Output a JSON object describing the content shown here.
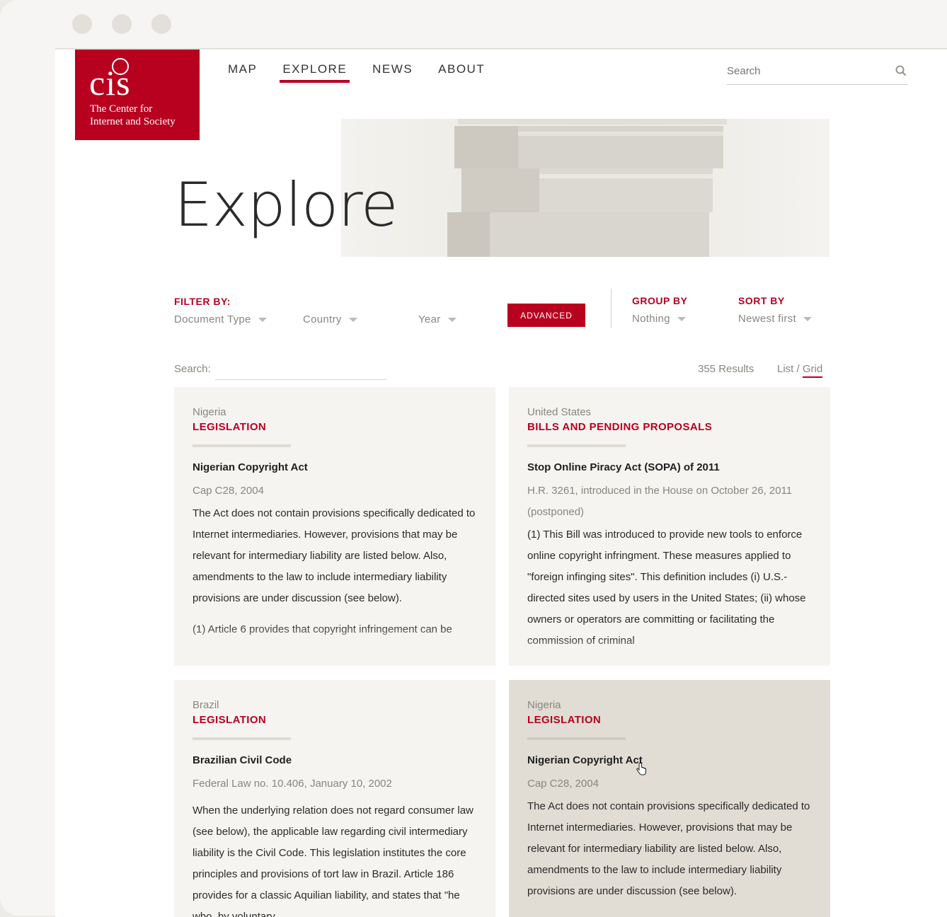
{
  "logo": {
    "mark": "cis",
    "line1": "The Center for",
    "line2": "Internet and Society"
  },
  "nav": {
    "items": [
      "MAP",
      "EXPLORE",
      "NEWS",
      "ABOUT"
    ],
    "active": "EXPLORE"
  },
  "search": {
    "placeholder": "Search"
  },
  "page": {
    "title": "Explore"
  },
  "filters": {
    "label": "FILTER BY:",
    "document_type": "Document Type",
    "country": "Country",
    "year": "Year",
    "advanced": "ADVANCED",
    "group_by_label": "GROUP BY",
    "group_by_value": "Nothing",
    "sort_by_label": "SORT BY",
    "sort_by_value": "Newest first"
  },
  "list_search": {
    "label": "Search:"
  },
  "results": {
    "count": "355 Results",
    "view_list": "List",
    "view_sep": "/",
    "view_grid": "Grid",
    "active_view": "Grid"
  },
  "colors": {
    "accent": "#b8001f",
    "card_bg": "#f5f4f1",
    "card_hover_bg": "#e1ddd4"
  },
  "cards": [
    {
      "country": "Nigeria",
      "doctype": "LEGISLATION",
      "title": "Nigerian Copyright Act",
      "sub": "Cap C28, 2004",
      "desc": "The Act does not contain provisions specifically dedicated to Internet intermediaries. However, provisions that may be relevant for intermediary liability are listed below. Also, amendments to the law to include intermediary liability provisions are under discussion (see below).",
      "desc2": "(1) Article 6 provides that copyright infringement can be"
    },
    {
      "country": "United States",
      "doctype": "BILLS AND PENDING PROPOSALS",
      "title": "Stop Online Piracy Act (SOPA) of 2011",
      "sub": "H.R. 3261, introduced in the House on October 26, 2011 (postponed)",
      "desc": "(1) This Bill was introduced to provide new tools to enforce online copyright infringment. These measures applied to \"foreign infinging sites\". This definition includes (i) U.S.-directed sites used by users in the United States; (ii) whose owners or operators are committing or facilitating the commission of criminal"
    },
    {
      "country": "Brazil",
      "doctype": "LEGISLATION",
      "title": "Brazilian Civil Code",
      "sub": "Federal Law no. 10.406, January 10, 2002",
      "desc": "When the underlying relation does not regard consumer law (see below), the applicable law regarding civil intermediary liability is the Civil Code. This legislation institutes the core principles and provisions of tort law in Brazil. Article 186 provides for a classic Aquilian liability, and states that \"he who, by voluntary"
    },
    {
      "country": "Nigeria",
      "doctype": "LEGISLATION",
      "title": "Nigerian Copyright Act",
      "sub": "Cap C28, 2004",
      "desc": "The Act does not contain provisions specifically dedicated to Internet intermediaries. However, provisions that may be relevant for intermediary liability are listed below. Also, amendments to the law to include intermediary liability provisions are under discussion (see below)."
    }
  ]
}
